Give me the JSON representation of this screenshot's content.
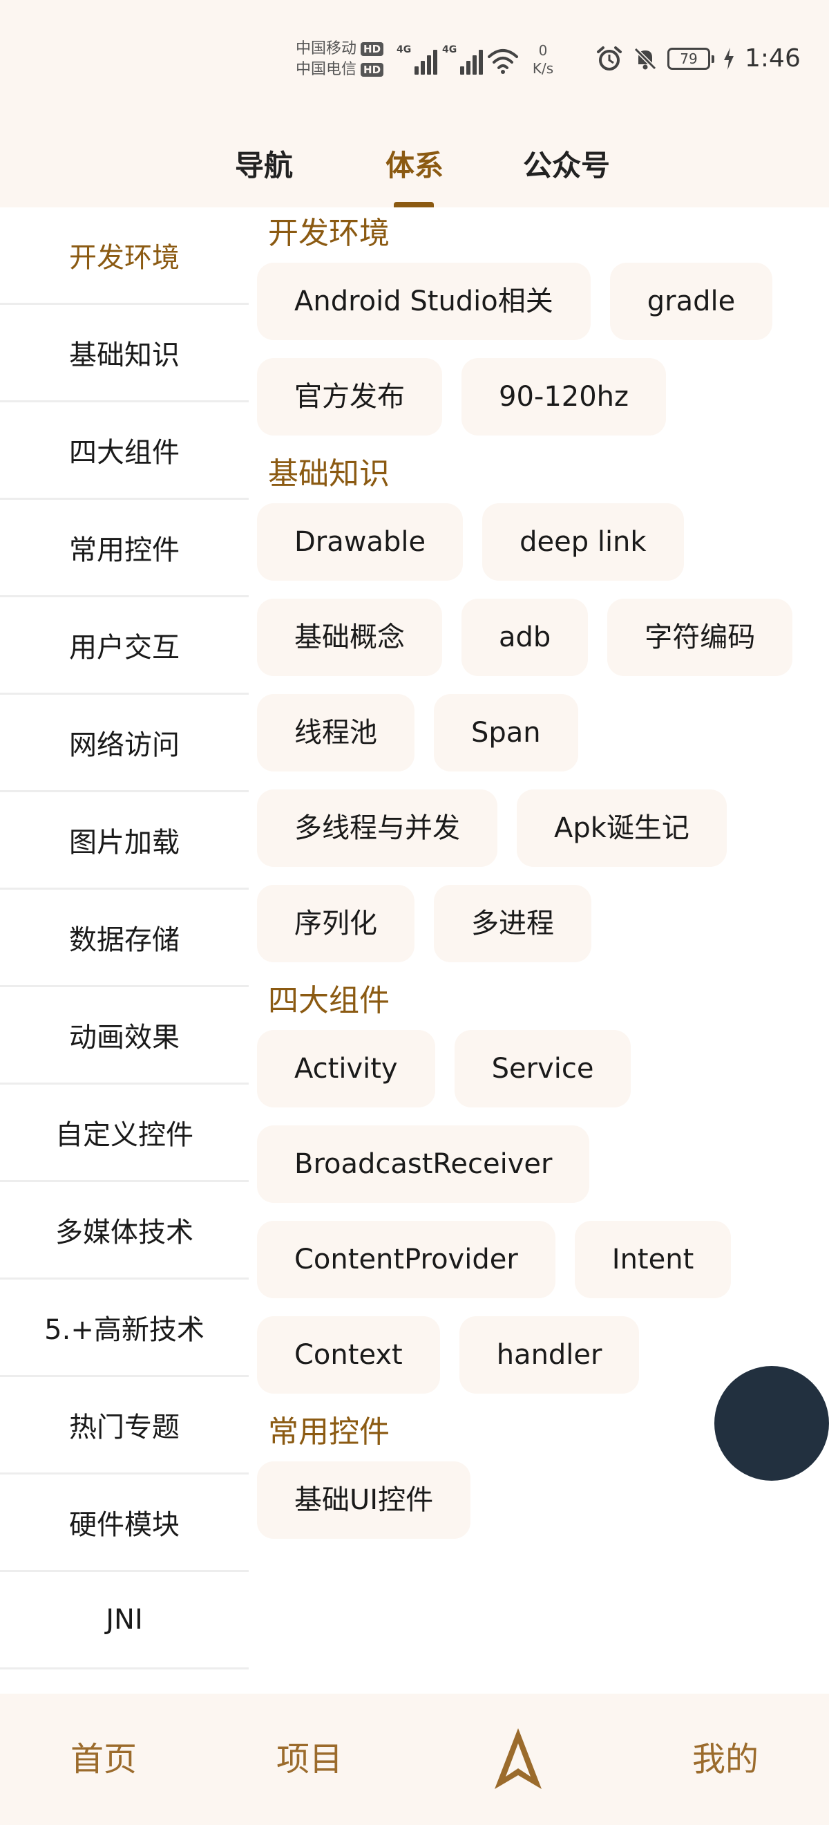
{
  "status_bar": {
    "carrier_1": "中国移动",
    "carrier_2": "中国电信",
    "hd_badge": "HD",
    "network_tag": "4G",
    "net_speed_value": "0",
    "net_speed_unit": "K/s",
    "battery": "79",
    "time": "1:46"
  },
  "top_tabs": [
    {
      "label": "导航",
      "active": false
    },
    {
      "label": "体系",
      "active": true
    },
    {
      "label": "公众号",
      "active": false
    }
  ],
  "sidebar": {
    "items": [
      {
        "label": "开发环境",
        "active": true
      },
      {
        "label": "基础知识",
        "active": false
      },
      {
        "label": "四大组件",
        "active": false
      },
      {
        "label": "常用控件",
        "active": false
      },
      {
        "label": "用户交互",
        "active": false
      },
      {
        "label": "网络访问",
        "active": false
      },
      {
        "label": "图片加载",
        "active": false
      },
      {
        "label": "数据存储",
        "active": false
      },
      {
        "label": "动画效果",
        "active": false
      },
      {
        "label": "自定义控件",
        "active": false
      },
      {
        "label": "多媒体技术",
        "active": false
      },
      {
        "label": "5.+高新技术",
        "active": false
      },
      {
        "label": "热门专题",
        "active": false
      },
      {
        "label": "硬件模块",
        "active": false
      },
      {
        "label": "JNI",
        "active": false
      }
    ]
  },
  "sections": [
    {
      "title": "开发环境",
      "chips": [
        "Android Studio相关",
        "gradle",
        "官方发布",
        "90-120hz"
      ]
    },
    {
      "title": "基础知识",
      "chips": [
        "Drawable",
        "deep link",
        "基础概念",
        "adb",
        "字符编码",
        "线程池",
        "Span",
        "多线程与并发",
        "Apk诞生记",
        "序列化",
        "多进程"
      ]
    },
    {
      "title": "四大组件",
      "chips": [
        "Activity",
        "Service",
        "BroadcastReceiver",
        "ContentProvider",
        "Intent",
        "Context",
        "handler"
      ]
    },
    {
      "title": "常用控件",
      "chips": [
        "基础UI控件"
      ]
    }
  ],
  "bottom_nav": {
    "items": [
      {
        "label": "首页"
      },
      {
        "label": "项目"
      },
      {
        "label": "我的"
      }
    ],
    "center_icon": "navigation-arrow-icon"
  },
  "colors": {
    "accent": "#8b5a12",
    "nav_text": "#9b6b2c",
    "chip_bg": "#fcf6f1",
    "header_bg": "#fcf6f1",
    "fab": "#22303f"
  }
}
